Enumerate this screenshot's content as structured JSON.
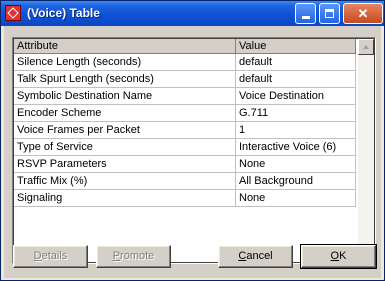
{
  "window": {
    "title": "(Voice) Table"
  },
  "table": {
    "headers": [
      "Attribute",
      "Value"
    ],
    "rows": [
      {
        "attribute": "Silence Length (seconds)",
        "value": "default"
      },
      {
        "attribute": "Talk Spurt Length (seconds)",
        "value": "default"
      },
      {
        "attribute": "Symbolic Destination Name",
        "value": "Voice Destination"
      },
      {
        "attribute": "Encoder Scheme",
        "value": "G.711"
      },
      {
        "attribute": "Voice Frames per Packet",
        "value": "1"
      },
      {
        "attribute": "Type of Service",
        "value": "Interactive Voice (6)"
      },
      {
        "attribute": "RSVP Parameters",
        "value": "None"
      },
      {
        "attribute": "Traffic Mix (%)",
        "value": "All Background"
      },
      {
        "attribute": "Signaling",
        "value": "None"
      }
    ]
  },
  "buttons": {
    "details": {
      "first": "D",
      "rest": "etails"
    },
    "promote": {
      "first": "P",
      "rest": "romote"
    },
    "cancel": {
      "first": "C",
      "rest": "ancel"
    },
    "ok": {
      "first": "O",
      "rest": "K"
    }
  },
  "icons": {
    "app": "app-icon",
    "minimize": "minimize-icon",
    "maximize": "maximize-icon",
    "close": "close-icon",
    "scroll_up": "scroll-up-icon",
    "scroll_down": "scroll-down-icon"
  }
}
